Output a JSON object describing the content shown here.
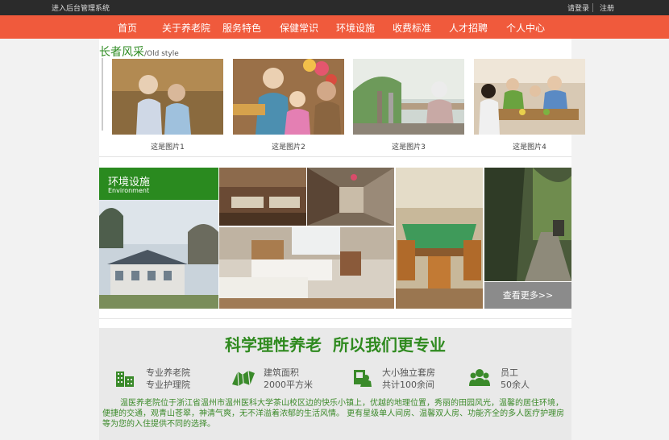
{
  "topbar": {
    "admin_link": "进入后台管理系统",
    "login": "请登录",
    "register": "注册"
  },
  "nav": {
    "items": [
      "首页",
      "关于养老院",
      "服务特色",
      "保健常识",
      "环境设施",
      "收费标准",
      "人才招聘",
      "个人中心"
    ]
  },
  "style_section": {
    "title_cn": "长者风采",
    "title_en": "/Old style",
    "photos": [
      {
        "caption": "这是图片1"
      },
      {
        "caption": "这是图片2"
      },
      {
        "caption": "这是图片3"
      },
      {
        "caption": "这是图片4"
      }
    ]
  },
  "environment": {
    "title_cn": "环境设施",
    "title_en": "Environment",
    "more_label": "查看更多>>"
  },
  "about": {
    "slogan": "科学理性养老  所以我们更专业",
    "stats": [
      {
        "icon": "building-icon",
        "line1": "专业养老院",
        "line2": "专业护理院"
      },
      {
        "icon": "map-icon",
        "line1": "建筑面积",
        "line2": "2000平方米"
      },
      {
        "icon": "room-icon",
        "line1": "大小独立套房",
        "line2": "共计100余间"
      },
      {
        "icon": "staff-icon",
        "line1": "员工",
        "line2": "50余人"
      }
    ],
    "description": "温医养老院位于浙江省温州市温州医科大学茶山校区边的快乐小镇上，优越的地理位置，秀丽的田园风光，温馨的居住环境，便捷的交通，观青山苍翠，神清气爽，无不洋溢着浓郁的生活风情。 更有星级单人间房、温馨双人房、功能齐全的多人医疗护理房等为您的入住提供不同的选择。"
  },
  "colors": {
    "nav_bg": "#f05a3c",
    "brand_green": "#2a8a1f",
    "topbar_bg": "#2b2b2b"
  }
}
